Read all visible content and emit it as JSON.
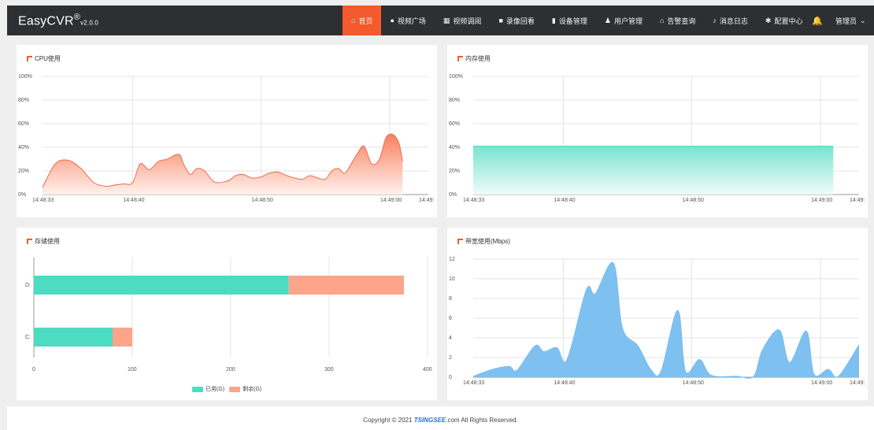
{
  "brand": {
    "name": "EasyCVR",
    "reg": "®",
    "version": "v2.0.0"
  },
  "nav": [
    {
      "label": "首页",
      "icon": "home-icon",
      "glyph": "⌂",
      "active": true
    },
    {
      "label": "视频广场",
      "icon": "play-circle-icon",
      "glyph": "●"
    },
    {
      "label": "视频调阅",
      "icon": "video-grid-icon",
      "glyph": "▦"
    },
    {
      "label": "录像回看",
      "icon": "camera-icon",
      "glyph": "■"
    },
    {
      "label": "设备管理",
      "icon": "device-icon",
      "glyph": "▮"
    },
    {
      "label": "用户管理",
      "icon": "user-icon",
      "glyph": "♟"
    },
    {
      "label": "告警查询",
      "icon": "alarm-icon",
      "glyph": "⌂"
    },
    {
      "label": "消息日志",
      "icon": "bell-small-icon",
      "glyph": "♪"
    },
    {
      "label": "配置中心",
      "icon": "gear-icon",
      "glyph": "✱"
    }
  ],
  "bell_glyph": "🔔",
  "admin": {
    "label": "管理员",
    "caret": "⌄"
  },
  "colors": {
    "accent": "#f45a2d",
    "topbar": "#2e2f33",
    "cpu": "#f8826a",
    "memory": "#5fdcc6",
    "used": "#4ddbc2",
    "free": "#fda48a",
    "bandwidth": "#79bdf0"
  },
  "panels": {
    "cpu": {
      "title": "CPU使用"
    },
    "memory": {
      "title": "内存使用"
    },
    "storage": {
      "title": "存储使用"
    },
    "bandwidth": {
      "title": "带宽使用(Mbps)"
    }
  },
  "chart_data": [
    {
      "id": "cpu",
      "type": "area",
      "title": "CPU使用",
      "ylim": [
        0,
        100
      ],
      "yticks": [
        "0%",
        "20%",
        "40%",
        "60%",
        "80%",
        "100%"
      ],
      "yvalues": [
        0,
        20,
        40,
        60,
        80,
        100
      ],
      "xlim": [
        "14:48:33",
        "14:49:03"
      ],
      "xticks": [
        {
          "t": 0,
          "label": "14:48:33"
        },
        {
          "t": 7,
          "label": "14:48:40"
        },
        {
          "t": 17,
          "label": "14:48:50"
        },
        {
          "t": 27,
          "label": "14:49:00"
        },
        {
          "t": 30,
          "label": "14:49:"
        }
      ],
      "series": [
        {
          "values": [
            [
              0,
              6
            ],
            [
              1,
              26
            ],
            [
              2,
              29
            ],
            [
              3,
              22
            ],
            [
              4,
              10
            ],
            [
              5,
              7
            ],
            [
              5.6,
              8
            ],
            [
              6.3,
              9
            ],
            [
              7,
              10
            ],
            [
              7.6,
              26
            ],
            [
              8.3,
              21
            ],
            [
              9,
              28
            ],
            [
              9.7,
              30
            ],
            [
              10.6,
              34
            ],
            [
              11,
              25
            ],
            [
              11.5,
              17
            ],
            [
              12,
              22
            ],
            [
              12.6,
              20
            ],
            [
              13.2,
              12
            ],
            [
              13.7,
              10
            ],
            [
              14.5,
              12
            ],
            [
              15,
              16
            ],
            [
              15.6,
              17
            ],
            [
              16.3,
              14
            ],
            [
              17,
              15
            ],
            [
              17.6,
              18
            ],
            [
              18.3,
              19
            ],
            [
              19,
              16
            ],
            [
              19.6,
              14
            ],
            [
              20.2,
              13
            ],
            [
              20.8,
              16
            ],
            [
              21.4,
              14
            ],
            [
              22,
              13
            ],
            [
              22.5,
              20
            ],
            [
              23,
              22
            ],
            [
              23.5,
              18
            ],
            [
              24,
              26
            ],
            [
              24.5,
              35
            ],
            [
              25,
              41
            ],
            [
              25.6,
              26
            ],
            [
              26.2,
              30
            ],
            [
              26.7,
              48
            ],
            [
              27.2,
              51
            ],
            [
              27.7,
              44
            ],
            [
              28,
              28
            ]
          ]
        }
      ]
    },
    {
      "id": "memory",
      "type": "area",
      "title": "内存使用",
      "ylim": [
        0,
        100
      ],
      "yticks": [
        "0%",
        "20%",
        "40%",
        "60%",
        "80%",
        "100%"
      ],
      "yvalues": [
        0,
        20,
        40,
        60,
        80,
        100
      ],
      "xlim": [
        "14:48:33",
        "14:49:03"
      ],
      "xticks": [
        {
          "t": 0,
          "label": "14:48:33"
        },
        {
          "t": 7,
          "label": "14:48:40"
        },
        {
          "t": 17,
          "label": "14:48:50"
        },
        {
          "t": 27,
          "label": "14:49:00"
        },
        {
          "t": 30,
          "label": "14:49:"
        }
      ],
      "series": [
        {
          "values": [
            [
              0,
              41
            ],
            [
              28,
              41
            ]
          ]
        }
      ]
    },
    {
      "id": "storage",
      "type": "bar",
      "orientation": "horizontal",
      "stacked": true,
      "title": "存储使用",
      "categories": [
        "D:",
        "C:"
      ],
      "xlim": [
        0,
        400
      ],
      "xticks": [
        "0",
        "100",
        "200",
        "300",
        "400"
      ],
      "xvalues": [
        0,
        100,
        200,
        300,
        400
      ],
      "legend_position": "bottom-center",
      "series": [
        {
          "name": "已用(G)",
          "values": [
            259,
            80
          ]
        },
        {
          "name": "剩余(G)",
          "values": [
            117,
            20
          ]
        }
      ]
    },
    {
      "id": "bandwidth",
      "type": "area",
      "title": "带宽使用(Mbps)",
      "ylim": [
        0,
        12
      ],
      "yticks": [
        "0",
        "2",
        "4",
        "6",
        "8",
        "10",
        "12"
      ],
      "yvalues": [
        0,
        2,
        4,
        6,
        8,
        10,
        12
      ],
      "xlim": [
        "14:48:33",
        "14:49:03"
      ],
      "xticks": [
        {
          "t": 0,
          "label": "14:48:33"
        },
        {
          "t": 7,
          "label": "14:48:40"
        },
        {
          "t": 17,
          "label": "14:48:50"
        },
        {
          "t": 27,
          "label": "14:49:00"
        },
        {
          "t": 30,
          "label": "14:49:"
        }
      ],
      "series": [
        {
          "values": [
            [
              0,
              0.1
            ],
            [
              1.5,
              0.8
            ],
            [
              2.8,
              1.1
            ],
            [
              3.4,
              0.7
            ],
            [
              4.8,
              3.2
            ],
            [
              5.5,
              2.6
            ],
            [
              6.5,
              3
            ],
            [
              7.3,
              1.8
            ],
            [
              8.8,
              8.9
            ],
            [
              9.5,
              8.5
            ],
            [
              10.9,
              11.6
            ],
            [
              11.6,
              5
            ],
            [
              12.8,
              3.2
            ],
            [
              13.8,
              0.8
            ],
            [
              14.6,
              0.6
            ],
            [
              15.9,
              6.8
            ],
            [
              16.5,
              0.6
            ],
            [
              17.6,
              1.8
            ],
            [
              18.5,
              0.2
            ],
            [
              20.5,
              0.1
            ],
            [
              21.8,
              0.1
            ],
            [
              22.5,
              2.8
            ],
            [
              23.8,
              4.8
            ],
            [
              24.6,
              1.5
            ],
            [
              25.9,
              4.7
            ],
            [
              26.5,
              0.3
            ],
            [
              27.6,
              0.8
            ],
            [
              28.4,
              0.1
            ],
            [
              30,
              3.3
            ]
          ]
        }
      ]
    }
  ],
  "footer": {
    "prefix": "Copyright © 2021 ",
    "brand": "TSINGSEE",
    "suffix": ".com All Rights Reserved."
  }
}
